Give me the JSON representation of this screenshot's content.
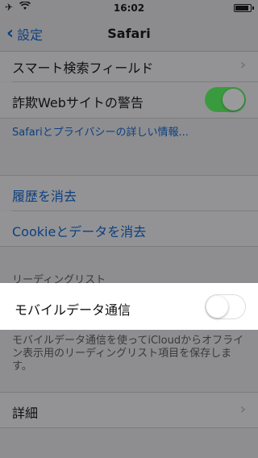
{
  "status_bar": {
    "time": "16:02",
    "airplane_icon": "airplane-icon",
    "wifi_icon": "wifi-icon",
    "battery_icon": "battery-icon",
    "battery_level": 0.9
  },
  "nav": {
    "back_label": "設定",
    "title": "Safari"
  },
  "rows": {
    "smart_search": "スマート検索フィールド",
    "fraud_warning": "詐欺Webサイトの警告",
    "fraud_warning_on": true,
    "privacy_link": "Safariとプライバシーの詳しい情報...",
    "clear_history": "履歴を消去",
    "clear_cookies": "Cookieとデータを消去",
    "reading_list_header": "リーディングリスト",
    "cellular_data": "モバイルデータ通信",
    "cellular_data_on": false,
    "cellular_footer": "モバイルデータ通信を使ってiCloudからオフライン表示用のリーディングリスト項目を保存します。",
    "advanced": "詳細"
  },
  "colors": {
    "link": "#0d3f80",
    "toggle_on": "#3a9b3e",
    "dim_overlay": "#8e8e90"
  }
}
